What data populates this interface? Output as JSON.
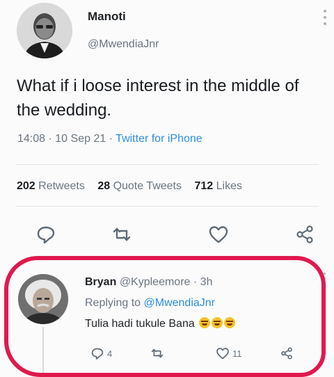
{
  "tweet": {
    "author_name": "Manoti",
    "author_handle": "@MwendiaJnr",
    "text": "What if i loose interest in the middle of the wedding.",
    "time": "14:08",
    "date": "10 Sep 21",
    "source": "Twitter for iPhone",
    "retweets": "202",
    "retweets_label": "Retweets",
    "quote_tweets": "28",
    "quote_tweets_label": "Quote Tweets",
    "likes": "712",
    "likes_label": "Likes",
    "icons": [
      "reply-icon",
      "retweet-icon",
      "like-icon",
      "share-icon",
      "more-icon"
    ]
  },
  "reply": {
    "author_name": "Bryan",
    "author_handle": "@Kypleemore",
    "age": "3h",
    "replying_to_label": "Replying to",
    "replying_to_handle": "@MwendiaJnr",
    "text": "Tulia hadi tukule Bana",
    "emoji": [
      "😂",
      "😂",
      "😂"
    ],
    "reply_count": "4",
    "like_count": "11",
    "icons": [
      "reply-icon",
      "retweet-icon",
      "like-icon",
      "share-icon",
      "more-icon"
    ]
  },
  "colors": {
    "background": "#fbfbfb",
    "link_blue": "#2d8de0",
    "meta_gray": "#6b7580",
    "highlight_red": "#e0194e",
    "emoji_yellow": "#f5c227"
  }
}
